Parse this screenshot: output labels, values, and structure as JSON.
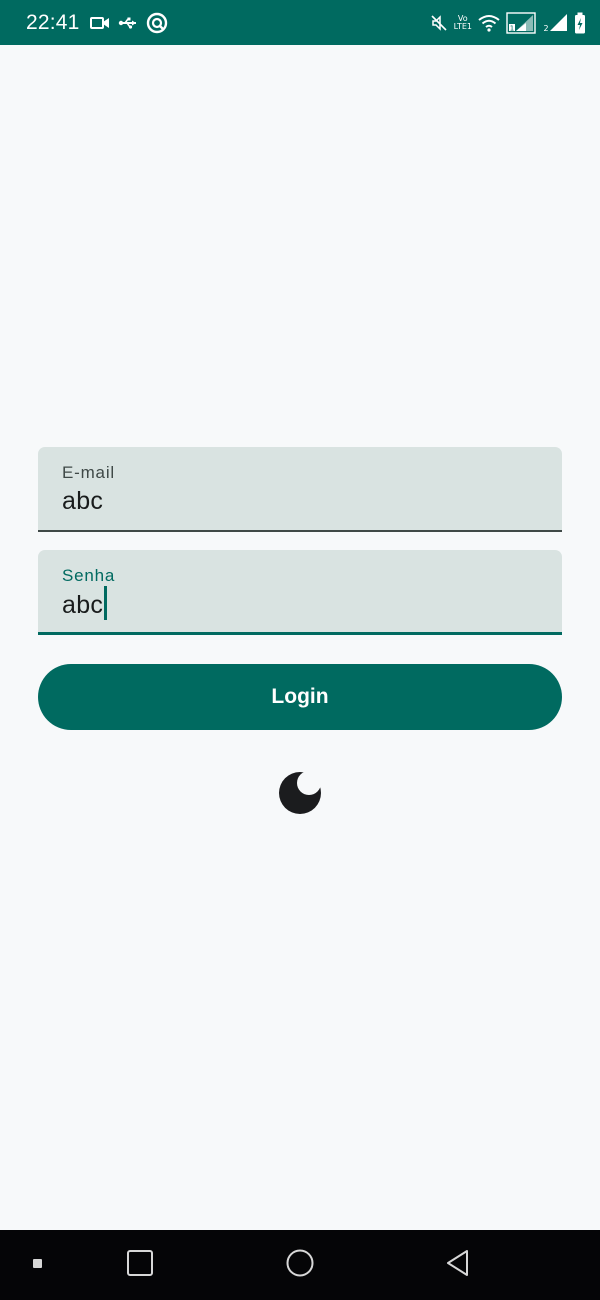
{
  "status_bar": {
    "time": "22:41",
    "left_icons": [
      "video-camera-icon",
      "usb-icon",
      "app-notification-icon"
    ],
    "right_icons": [
      "mute-icon",
      "volte-icon",
      "wifi-icon",
      "signal-sim1-icon",
      "signal-sim2-icon",
      "battery-charging-icon"
    ],
    "volte_top": "Vo",
    "volte_bottom": "LTE1",
    "background": "#006a60"
  },
  "form": {
    "email": {
      "label": "E-mail",
      "value": "abc"
    },
    "password": {
      "label": "Senha",
      "value": "abc"
    },
    "login_label": "Login"
  },
  "theme_toggle": {
    "icon": "moon-icon"
  },
  "nav_bar": {
    "buttons": [
      "recents-button",
      "home-button",
      "back-button"
    ]
  },
  "colors": {
    "accent": "#006a60",
    "field_background": "#d9e3e1",
    "page_background": "#f7f9fa",
    "text": "#191c1c"
  }
}
